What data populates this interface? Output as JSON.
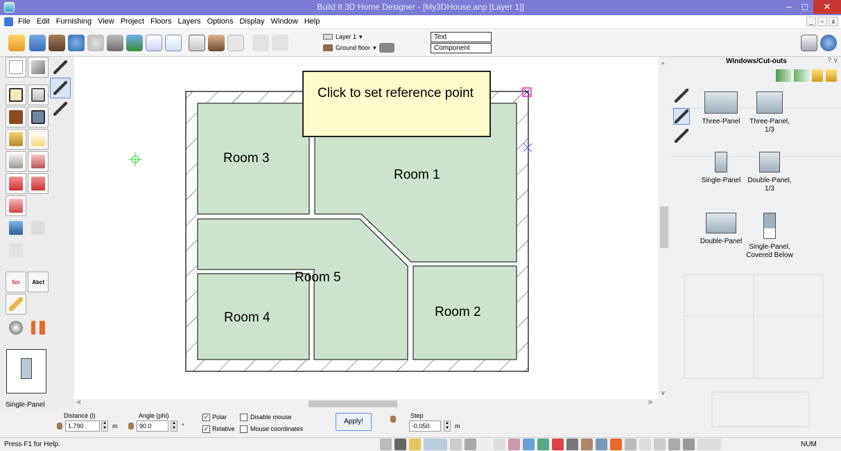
{
  "window": {
    "title": "Build It 3D Home Designer - [My3DHouse.anp [Layer 1]]",
    "min": "–",
    "max": "▢",
    "close": "✕"
  },
  "menu": {
    "items": [
      "File",
      "Edit",
      "Furnishing",
      "View",
      "Project",
      "Floors",
      "Layers",
      "Options",
      "Display",
      "Window",
      "Help"
    ],
    "mdi": [
      "_",
      "▫",
      "x"
    ]
  },
  "toolbar": {
    "layer_select": "Layer 1",
    "floor_select": "Ground floor",
    "text_field": "Text",
    "component_field": "Component"
  },
  "canvas": {
    "tooltip": "Click to set reference point",
    "rooms": [
      "Room 1",
      "Room 2",
      "Room 3",
      "Room 4",
      "Room 5"
    ]
  },
  "left_panel": {
    "dimension_tool": "5m",
    "text_tool": "AbcI",
    "preview_label": "Single-Panel"
  },
  "right_panel": {
    "title": "Windows/Cut-outs",
    "controls": "? ∨",
    "items": [
      {
        "label": "Three-Panel"
      },
      {
        "label": "Three-Panel, 1/3"
      },
      {
        "label": "Single-Panel"
      },
      {
        "label": "Double-Panel, 1/3"
      },
      {
        "label": "Double-Panel"
      },
      {
        "label": "Single-Panel, Covered Below"
      }
    ]
  },
  "inputs": {
    "distance_label": "Distance (l)",
    "distance_value": "1.790",
    "distance_unit": "m",
    "angle_label": "Angle (phi)",
    "angle_value": "90.0",
    "angle_unit": "°",
    "polar_label": "Polar",
    "polar_checked": true,
    "relative_label": "Relative",
    "relative_checked": true,
    "disable_mouse_label": "Disable mouse",
    "mouse_coords_label": "Mouse coordinates",
    "apply_label": "Apply!",
    "step_label": "Step",
    "step_value": "-0.050",
    "step_unit": "m"
  },
  "status": {
    "help": "Press F1 for Help.",
    "num": "NUM"
  },
  "colors": {
    "titlebar": "#7b7bd6",
    "room_fill": "#cde3cd",
    "tooltip_bg": "#fefccb",
    "close_btn": "#c7372f"
  }
}
